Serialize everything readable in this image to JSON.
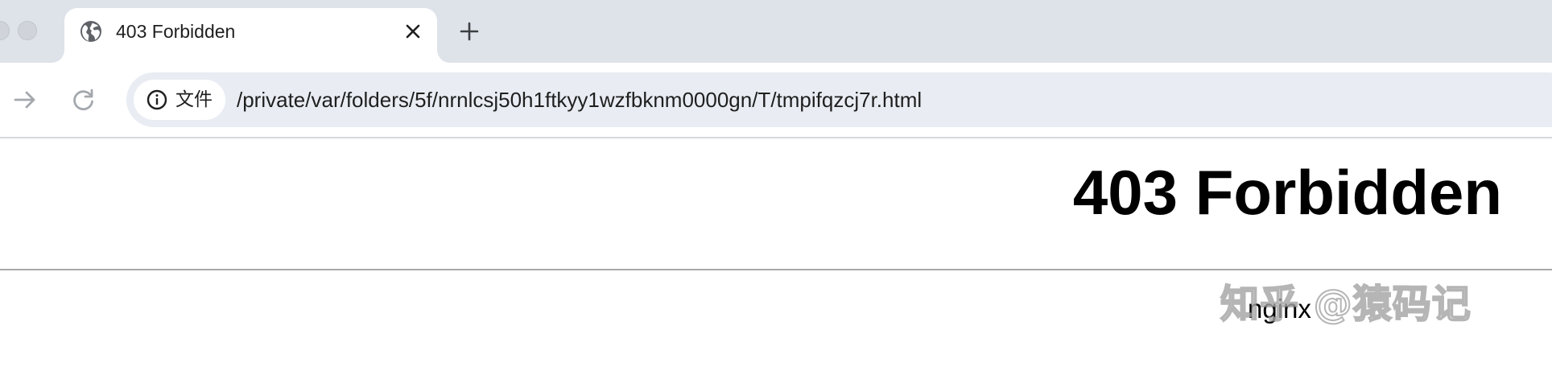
{
  "tab": {
    "title": "403 Forbidden"
  },
  "omnibox": {
    "security_chip_label": "文件",
    "url": "/private/var/folders/5f/nrnlcsj50h1ftkyy1wzfbknm0000gn/T/tmpifqzcj7r.html"
  },
  "page": {
    "heading": "403 Forbidden",
    "server_name": "nginx"
  },
  "watermark": {
    "text": "知乎 @猿码记"
  },
  "icons": {
    "favicon": "globe-icon",
    "tab_close": "close-icon",
    "new_tab": "plus-icon",
    "forward": "arrow-right-icon",
    "reload": "reload-icon",
    "security": "info-icon"
  },
  "colors": {
    "tabstrip_bg": "#dee3ea",
    "omnibox_bg": "#e9edf3",
    "text": "#1f1f1f",
    "rule": "#a9a9a9"
  }
}
